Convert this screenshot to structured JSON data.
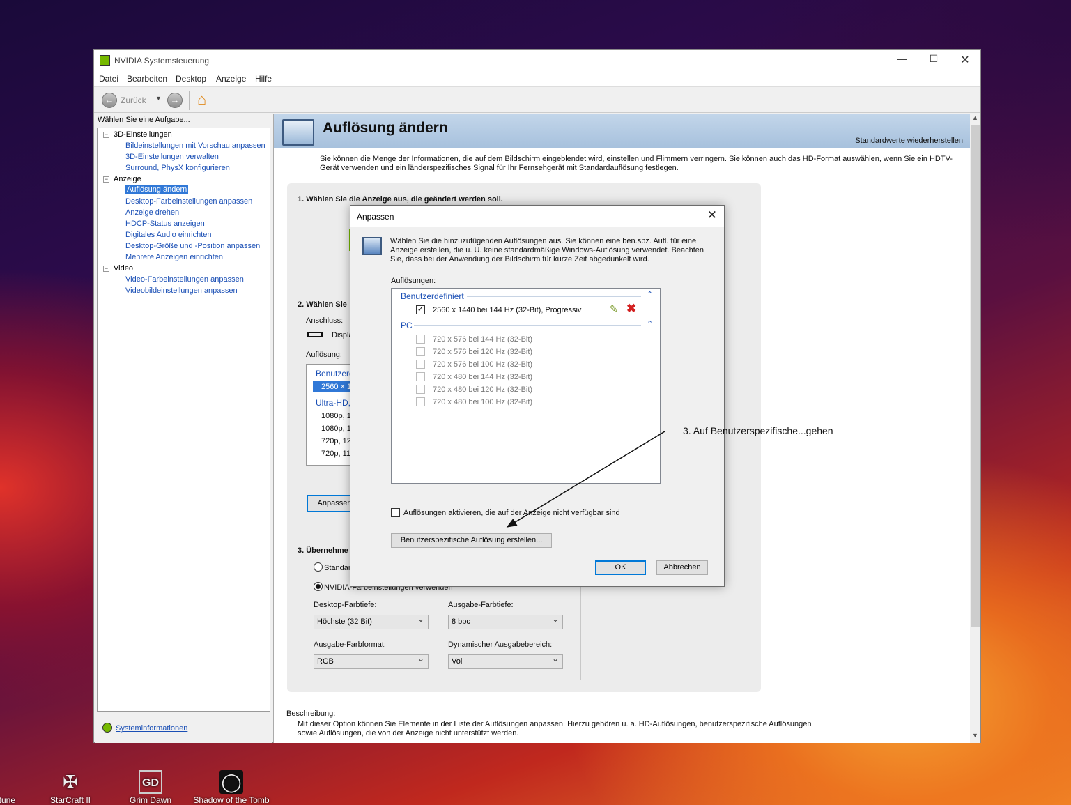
{
  "desktop": {
    "icons": [
      {
        "label": "ortune"
      },
      {
        "label": "StarCraft II"
      },
      {
        "label": "Grim Dawn"
      },
      {
        "label": "Shadow of the Tomb"
      }
    ]
  },
  "window": {
    "title": "NVIDIA Systemsteuerung",
    "menu": [
      "Datei",
      "Bearbeiten",
      "Desktop",
      "Anzeige",
      "Hilfe"
    ],
    "toolbar": {
      "back_label": "Zurück"
    }
  },
  "sidebar": {
    "heading": "Wählen Sie eine Aufgabe...",
    "groups": [
      {
        "label": "3D-Einstellungen",
        "items": [
          "Bildeinstellungen mit Vorschau anpassen",
          "3D-Einstellungen verwalten",
          "Surround, PhysX konfigurieren"
        ]
      },
      {
        "label": "Anzeige",
        "items": [
          "Auflösung ändern",
          "Desktop-Farbeinstellungen anpassen",
          "Anzeige drehen",
          "HDCP-Status anzeigen",
          "Digitales Audio einrichten",
          "Desktop-Größe und -Position anpassen",
          "Mehrere Anzeigen einrichten"
        ]
      },
      {
        "label": "Video",
        "items": [
          "Video-Farbeinstellungen anpassen",
          "Videobildeinstellungen anpassen"
        ]
      }
    ],
    "footer_link": "Systeminformationen"
  },
  "page": {
    "title": "Auflösung ändern",
    "restore_link": "Standardwerte wiederherstellen",
    "intro": "Sie können die Menge der Informationen, die auf dem Bildschirm eingeblendet wird, einstellen und Flimmern verringern. Sie können auch das HD-Format auswählen, wenn Sie ein HDTV-Gerät verwenden und ein länderspezifisches Signal für Ihr Fernsehgerät mit Standardauflösung festlegen.",
    "step1": "1. Wählen Sie die Anzeige aus, die geändert werden soll.",
    "step2": "2. Wählen Sie",
    "connection_label": "Anschluss:",
    "connection_value": "Displa",
    "resolution_label": "Auflösung:",
    "res_list": {
      "group1": "Benutzerd",
      "selected": "2560 × 1",
      "group2": "Ultra-HD,",
      "items": [
        "1080p, 1",
        "1080p, 1",
        "720p, 12",
        "720p, 11"
      ]
    },
    "customize_button": "Anpassen",
    "step3": "3. Übernehme",
    "radio_default": "Standar",
    "radio_nvidia": "NVIDIA-Farbeinstellungen verwenden",
    "desktop_depth_label": "Desktop-Farbtiefe:",
    "desktop_depth_value": "Höchste (32 Bit)",
    "output_depth_label": "Ausgabe-Farbtiefe:",
    "output_depth_value": "8 bpc",
    "output_format_label": "Ausgabe-Farbformat:",
    "output_format_value": "RGB",
    "dynamic_range_label": "Dynamischer Ausgabebereich:",
    "dynamic_range_value": "Voll",
    "description_label": "Beschreibung:",
    "description_text": "Mit dieser Option können Sie Elemente in der Liste der Auflösungen anpassen. Hierzu gehören u. a. HD-Auflösungen, benutzerspezifische Auflösungen sowie Auflösungen, die von der Anzeige nicht unterstützt werden."
  },
  "dialog": {
    "title": "Anpassen",
    "intro": "Wählen Sie die hinzuzufügenden Auflösungen aus. Sie können eine ben.spz. Aufl. für eine Anzeige erstellen, die u. U. keine standardmäßige Windows-Auflösung verwendet. Beachten Sie, dass bei der Anwendung der Bildschirm für kurze Zeit abgedunkelt wird.",
    "list_label": "Auflösungen:",
    "custom_group": "Benutzerdefiniert",
    "custom_item": "2560 x 1440 bei 144 Hz (32-Bit), Progressiv",
    "pc_group": "PC",
    "pc_items": [
      "720 x 576 bei 144 Hz (32-Bit)",
      "720 x 576 bei 120 Hz (32-Bit)",
      "720 x 576 bei 100 Hz (32-Bit)",
      "720 x 480 bei 144 Hz (32-Bit)",
      "720 x 480 bei 120 Hz (32-Bit)",
      "720 x 480 bei 100 Hz (32-Bit)"
    ],
    "enable_checkbox": "Auflösungen aktivieren, die auf der Anzeige nicht verfügbar sind",
    "create_button": "Benutzerspezifische Auflösung erstellen...",
    "ok": "OK",
    "cancel": "Abbrechen"
  },
  "annotation": "3. Auf Benutzerspezifische...gehen",
  "colors": {
    "accent": "#0078d7",
    "link": "#1a4fb5",
    "nvidia_green": "#76b900",
    "delete_red": "#d32020"
  }
}
